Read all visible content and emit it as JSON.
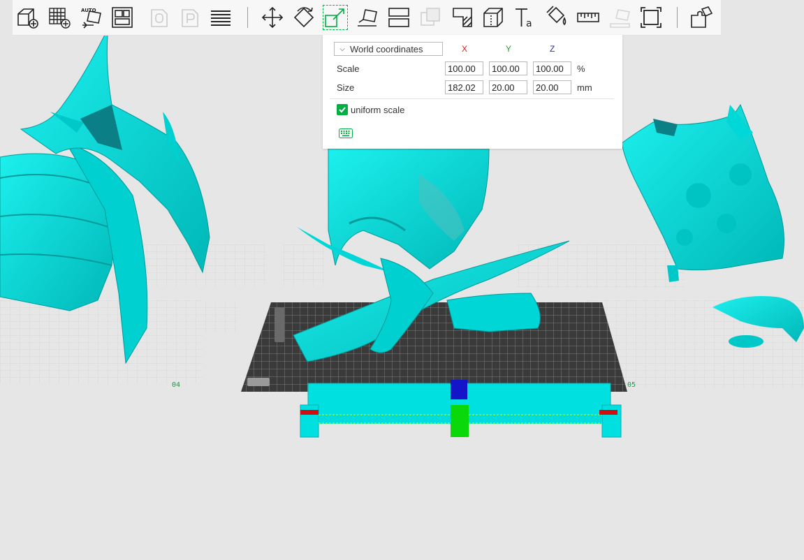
{
  "toolbar": {
    "items": [
      {
        "icon": "add-object-icon"
      },
      {
        "icon": "add-plate-icon"
      },
      {
        "icon": "auto-orient-icon",
        "text": "AUTO"
      },
      {
        "icon": "arrange-icon"
      },
      {
        "icon": "split-to-objects-icon",
        "state": "disabled"
      },
      {
        "icon": "split-to-parts-icon",
        "state": "disabled"
      },
      {
        "icon": "variable-layer-height-icon"
      },
      {
        "icon": "move-icon"
      },
      {
        "icon": "rotate-icon"
      },
      {
        "icon": "scale-icon",
        "state": "active"
      },
      {
        "icon": "lay-on-face-icon"
      },
      {
        "icon": "cut-icon"
      },
      {
        "icon": "boolean-icon",
        "state": "disabled"
      },
      {
        "icon": "support-painting-icon"
      },
      {
        "icon": "seam-painting-icon"
      },
      {
        "icon": "text-icon"
      },
      {
        "icon": "color-painting-icon"
      },
      {
        "icon": "measure-icon"
      },
      {
        "icon": "assembly-icon",
        "state": "disabled"
      },
      {
        "icon": "fullscreen-icon"
      },
      {
        "icon": "assembly-view-icon"
      }
    ]
  },
  "scale_panel": {
    "coordinate_mode": "World coordinates",
    "axis_labels": {
      "x": "X",
      "y": "Y",
      "z": "Z"
    },
    "axis_colors": {
      "x": "#d42020",
      "y": "#2a9a2a",
      "z": "#2a2aa8"
    },
    "scale": {
      "label": "Scale",
      "x": "100.00",
      "y": "100.00",
      "z": "100.00",
      "unit": "%"
    },
    "size": {
      "label": "Size",
      "x": "182.02",
      "y": "20.00",
      "z": "20.00",
      "unit": "mm"
    },
    "uniform_scale": {
      "label": "uniform scale",
      "checked": true
    },
    "keyboard_icon": "keyboard-icon"
  },
  "viewport": {
    "plate_labels": [
      "04",
      "05"
    ],
    "colors": {
      "model": "#00e5e5",
      "plate": "#3a3a3a",
      "grid": "#8a8a8a",
      "accent": "#00ae42"
    }
  }
}
